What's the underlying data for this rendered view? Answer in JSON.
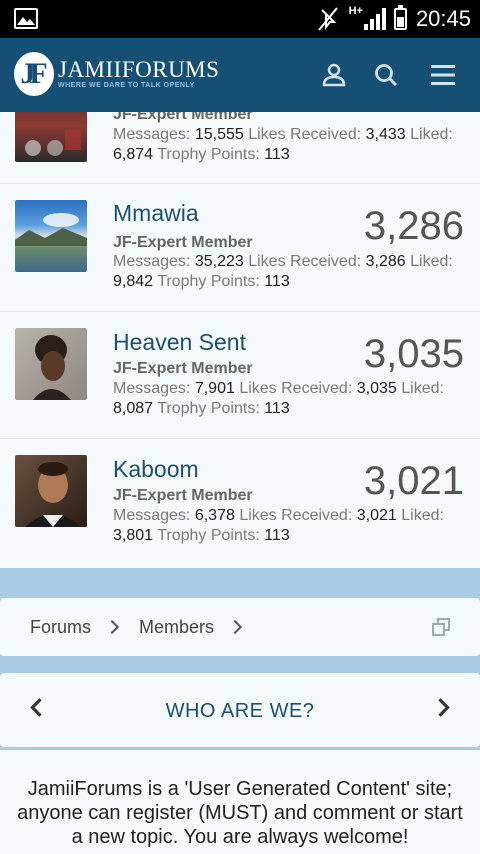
{
  "status_bar": {
    "network": "H+",
    "time": "20:45",
    "icons": [
      "gallery-icon",
      "mute-icon",
      "signal-icon",
      "battery-icon"
    ]
  },
  "header": {
    "logo_mark": "JF",
    "brand_name": "JAMIIFORUMS",
    "tagline": "WHERE WE DARE TO TALK OPENLY",
    "icons": [
      "user-icon",
      "search-icon",
      "menu-icon"
    ],
    "colors": {
      "bar": "#154f73",
      "tagline": "#8ec3e6"
    }
  },
  "members": [
    {
      "name": "",
      "title": "JF-Expert Member",
      "messages_label": "Messages:",
      "messages": "15,555",
      "likes_received_label": "Likes Received:",
      "likes_received": "3,433",
      "liked_label": "Liked:",
      "liked": "6,874",
      "trophy_label": "Trophy Points:",
      "trophy_points": "113",
      "score": ""
    },
    {
      "name": "Mmawia",
      "title": "JF-Expert Member",
      "messages_label": "Messages:",
      "messages": "35,223",
      "likes_received_label": "Likes Received:",
      "likes_received": "3,286",
      "liked_label": "Liked:",
      "liked": "9,842",
      "trophy_label": "Trophy Points:",
      "trophy_points": "113",
      "score": "3,286"
    },
    {
      "name": "Heaven Sent",
      "title": "JF-Expert Member",
      "messages_label": "Messages:",
      "messages": "7,901",
      "likes_received_label": "Likes Received:",
      "likes_received": "3,035",
      "liked_label": "Liked:",
      "liked": "8,087",
      "trophy_label": "Trophy Points:",
      "trophy_points": "113",
      "score": "3,035"
    },
    {
      "name": "Kaboom",
      "title": "JF-Expert Member",
      "messages_label": "Messages:",
      "messages": "6,378",
      "likes_received_label": "Likes Received:",
      "likes_received": "3,021",
      "liked_label": "Liked:",
      "liked": "3,801",
      "trophy_label": "Trophy Points:",
      "trophy_points": "113",
      "score": "3,021"
    }
  ],
  "breadcrumb": {
    "items": [
      "Forums",
      "Members"
    ],
    "icon": "overlay-icon"
  },
  "who_are_we": {
    "title": "WHO ARE WE?",
    "prev_icon": "chevron-left-icon",
    "next_icon": "chevron-right-icon"
  },
  "about": {
    "text": "JamiiForums is a 'User Generated Content' site; anyone can register (MUST) and comment or start a new topic. You are always welcome!"
  }
}
